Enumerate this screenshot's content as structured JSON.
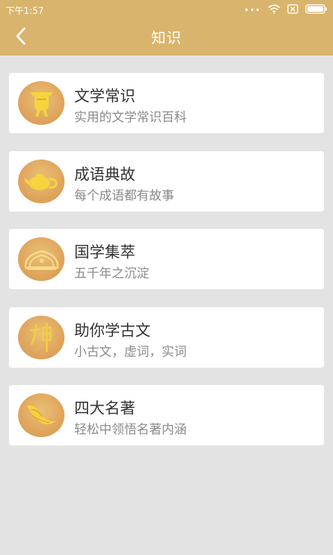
{
  "status": {
    "time": "下午1:57",
    "dots": "•••"
  },
  "header": {
    "title": "知识"
  },
  "items": [
    {
      "title": "文学常识",
      "subtitle": "实用的文学常识百科",
      "icon": "bronze-vessel-icon"
    },
    {
      "title": "成语典故",
      "subtitle": "每个成语都有故事",
      "icon": "teapot-icon"
    },
    {
      "title": "国学集萃",
      "subtitle": "五千年之沉淀",
      "icon": "scroll-ornament-icon"
    },
    {
      "title": "助你学古文",
      "subtitle": "小古文，虚词，实词",
      "icon": "calligraphy-icon"
    },
    {
      "title": "四大名著",
      "subtitle": "轻松中领悟名著内涵",
      "icon": "books-icon"
    }
  ],
  "colors": {
    "accent": "#d9b46c",
    "background": "#e3e3e3",
    "title": "#333333",
    "subtitle": "#8a8a8a"
  }
}
